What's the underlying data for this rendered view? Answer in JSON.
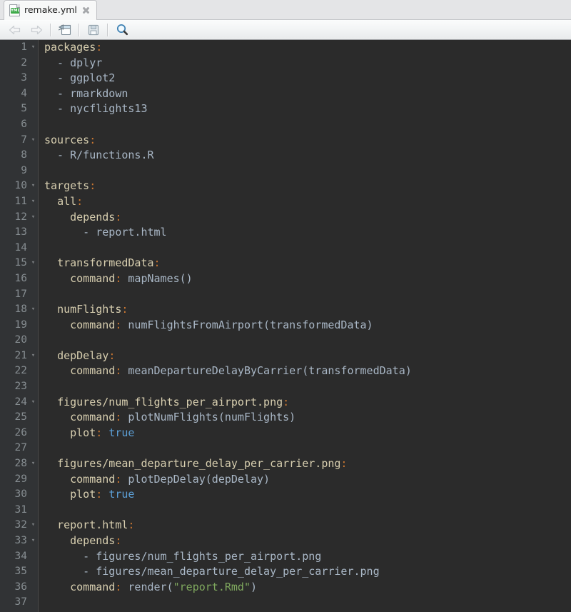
{
  "window": {
    "title": "remake.yml"
  },
  "tab": {
    "label": "remake.yml",
    "icon": "yml-file-icon",
    "badge_text": "YML",
    "close_label": "×"
  },
  "toolbar": {
    "buttons": [
      {
        "name": "back-button",
        "icon": "arrow-left-icon",
        "enabled": false
      },
      {
        "name": "forward-button",
        "icon": "arrow-right-icon",
        "enabled": false
      },
      {
        "name": "open-button",
        "icon": "open-folder-icon",
        "enabled": true
      },
      {
        "name": "save-button",
        "icon": "floppy-disk-icon",
        "enabled": true
      },
      {
        "name": "search-button",
        "icon": "magnifier-icon",
        "enabled": true
      }
    ]
  },
  "editor": {
    "language": "yaml",
    "first_line": 1,
    "lines": [
      {
        "n": 1,
        "fold": true,
        "tokens": [
          {
            "t": "key",
            "v": "packages"
          },
          {
            "t": "colon",
            "v": ":"
          }
        ]
      },
      {
        "n": 2,
        "fold": false,
        "tokens": [
          {
            "t": "plain",
            "v": "  - "
          },
          {
            "t": "val",
            "v": "dplyr"
          }
        ]
      },
      {
        "n": 3,
        "fold": false,
        "tokens": [
          {
            "t": "plain",
            "v": "  - "
          },
          {
            "t": "val",
            "v": "ggplot2"
          }
        ]
      },
      {
        "n": 4,
        "fold": false,
        "tokens": [
          {
            "t": "plain",
            "v": "  - "
          },
          {
            "t": "val",
            "v": "rmarkdown"
          }
        ]
      },
      {
        "n": 5,
        "fold": false,
        "tokens": [
          {
            "t": "plain",
            "v": "  - "
          },
          {
            "t": "val",
            "v": "nycflights13"
          }
        ]
      },
      {
        "n": 6,
        "fold": false,
        "tokens": []
      },
      {
        "n": 7,
        "fold": true,
        "tokens": [
          {
            "t": "key",
            "v": "sources"
          },
          {
            "t": "colon",
            "v": ":"
          }
        ]
      },
      {
        "n": 8,
        "fold": false,
        "tokens": [
          {
            "t": "plain",
            "v": "  - "
          },
          {
            "t": "val",
            "v": "R/functions.R"
          }
        ]
      },
      {
        "n": 9,
        "fold": false,
        "tokens": []
      },
      {
        "n": 10,
        "fold": true,
        "tokens": [
          {
            "t": "key",
            "v": "targets"
          },
          {
            "t": "colon",
            "v": ":"
          }
        ]
      },
      {
        "n": 11,
        "fold": true,
        "tokens": [
          {
            "t": "plain",
            "v": "  "
          },
          {
            "t": "key",
            "v": "all"
          },
          {
            "t": "colon",
            "v": ":"
          }
        ]
      },
      {
        "n": 12,
        "fold": true,
        "tokens": [
          {
            "t": "plain",
            "v": "    "
          },
          {
            "t": "key",
            "v": "depends"
          },
          {
            "t": "colon",
            "v": ":"
          }
        ]
      },
      {
        "n": 13,
        "fold": false,
        "tokens": [
          {
            "t": "plain",
            "v": "      - "
          },
          {
            "t": "val",
            "v": "report.html"
          }
        ]
      },
      {
        "n": 14,
        "fold": false,
        "tokens": []
      },
      {
        "n": 15,
        "fold": true,
        "tokens": [
          {
            "t": "plain",
            "v": "  "
          },
          {
            "t": "key",
            "v": "transformedData"
          },
          {
            "t": "colon",
            "v": ":"
          }
        ]
      },
      {
        "n": 16,
        "fold": false,
        "tokens": [
          {
            "t": "plain",
            "v": "    "
          },
          {
            "t": "key",
            "v": "command"
          },
          {
            "t": "colon",
            "v": ":"
          },
          {
            "t": "val",
            "v": " mapNames()"
          }
        ]
      },
      {
        "n": 17,
        "fold": false,
        "tokens": []
      },
      {
        "n": 18,
        "fold": true,
        "tokens": [
          {
            "t": "plain",
            "v": "  "
          },
          {
            "t": "key",
            "v": "numFlights"
          },
          {
            "t": "colon",
            "v": ":"
          }
        ]
      },
      {
        "n": 19,
        "fold": false,
        "tokens": [
          {
            "t": "plain",
            "v": "    "
          },
          {
            "t": "key",
            "v": "command"
          },
          {
            "t": "colon",
            "v": ":"
          },
          {
            "t": "val",
            "v": " numFlightsFromAirport(transformedData)"
          }
        ]
      },
      {
        "n": 20,
        "fold": false,
        "tokens": []
      },
      {
        "n": 21,
        "fold": true,
        "tokens": [
          {
            "t": "plain",
            "v": "  "
          },
          {
            "t": "key",
            "v": "depDelay"
          },
          {
            "t": "colon",
            "v": ":"
          }
        ]
      },
      {
        "n": 22,
        "fold": false,
        "tokens": [
          {
            "t": "plain",
            "v": "    "
          },
          {
            "t": "key",
            "v": "command"
          },
          {
            "t": "colon",
            "v": ":"
          },
          {
            "t": "val",
            "v": " meanDepartureDelayByCarrier(transformedData)"
          }
        ]
      },
      {
        "n": 23,
        "fold": false,
        "tokens": []
      },
      {
        "n": 24,
        "fold": true,
        "tokens": [
          {
            "t": "plain",
            "v": "  "
          },
          {
            "t": "key",
            "v": "figures/num_flights_per_airport.png"
          },
          {
            "t": "colon",
            "v": ":"
          }
        ]
      },
      {
        "n": 25,
        "fold": false,
        "tokens": [
          {
            "t": "plain",
            "v": "    "
          },
          {
            "t": "key",
            "v": "command"
          },
          {
            "t": "colon",
            "v": ":"
          },
          {
            "t": "val",
            "v": " plotNumFlights(numFlights)"
          }
        ]
      },
      {
        "n": 26,
        "fold": false,
        "tokens": [
          {
            "t": "plain",
            "v": "    "
          },
          {
            "t": "key",
            "v": "plot"
          },
          {
            "t": "colon",
            "v": ":"
          },
          {
            "t": "plain",
            "v": " "
          },
          {
            "t": "bool",
            "v": "true"
          }
        ]
      },
      {
        "n": 27,
        "fold": false,
        "tokens": []
      },
      {
        "n": 28,
        "fold": true,
        "tokens": [
          {
            "t": "plain",
            "v": "  "
          },
          {
            "t": "key",
            "v": "figures/mean_departure_delay_per_carrier.png"
          },
          {
            "t": "colon",
            "v": ":"
          }
        ]
      },
      {
        "n": 29,
        "fold": false,
        "tokens": [
          {
            "t": "plain",
            "v": "    "
          },
          {
            "t": "key",
            "v": "command"
          },
          {
            "t": "colon",
            "v": ":"
          },
          {
            "t": "val",
            "v": " plotDepDelay(depDelay)"
          }
        ]
      },
      {
        "n": 30,
        "fold": false,
        "tokens": [
          {
            "t": "plain",
            "v": "    "
          },
          {
            "t": "key",
            "v": "plot"
          },
          {
            "t": "colon",
            "v": ":"
          },
          {
            "t": "plain",
            "v": " "
          },
          {
            "t": "bool",
            "v": "true"
          }
        ]
      },
      {
        "n": 31,
        "fold": false,
        "tokens": []
      },
      {
        "n": 32,
        "fold": true,
        "tokens": [
          {
            "t": "plain",
            "v": "  "
          },
          {
            "t": "key",
            "v": "report.html"
          },
          {
            "t": "colon",
            "v": ":"
          }
        ]
      },
      {
        "n": 33,
        "fold": true,
        "tokens": [
          {
            "t": "plain",
            "v": "    "
          },
          {
            "t": "key",
            "v": "depends"
          },
          {
            "t": "colon",
            "v": ":"
          }
        ]
      },
      {
        "n": 34,
        "fold": false,
        "tokens": [
          {
            "t": "plain",
            "v": "      - "
          },
          {
            "t": "val",
            "v": "figures/num_flights_per_airport.png"
          }
        ]
      },
      {
        "n": 35,
        "fold": false,
        "tokens": [
          {
            "t": "plain",
            "v": "      - "
          },
          {
            "t": "val",
            "v": "figures/mean_departure_delay_per_carrier.png"
          }
        ]
      },
      {
        "n": 36,
        "fold": false,
        "tokens": [
          {
            "t": "plain",
            "v": "    "
          },
          {
            "t": "key",
            "v": "command"
          },
          {
            "t": "colon",
            "v": ":"
          },
          {
            "t": "val",
            "v": " render("
          },
          {
            "t": "str",
            "v": "\"report.Rmd\""
          },
          {
            "t": "val",
            "v": ")"
          }
        ]
      },
      {
        "n": 37,
        "fold": false,
        "tokens": []
      }
    ],
    "fold_glyph": "▾"
  },
  "colors": {
    "editor_background": "#2b2b2b",
    "gutter_background": "#313335",
    "line_number": "#868d91",
    "key": "#d8cfb0",
    "colon": "#cc7832",
    "value": "#a9b7c6",
    "boolean": "#5c9fd6",
    "string": "#7fa85e",
    "tabbar_background": "#e4e5e7",
    "toolbar_background": "#f1f3f4",
    "icon_green": "#3faa4a"
  }
}
